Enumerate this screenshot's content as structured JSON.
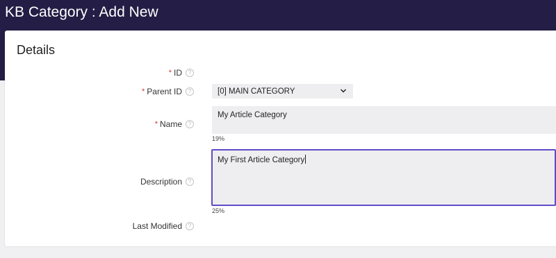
{
  "header": {
    "title": "KB Category : Add New"
  },
  "section": {
    "title": "Details"
  },
  "fields": {
    "id": {
      "label": "ID",
      "required": "*"
    },
    "parent_id": {
      "label": "Parent ID",
      "required": "*",
      "value": "[0] MAIN CATEGORY"
    },
    "name": {
      "label": "Name",
      "required": "*",
      "value": "My Article Category",
      "fill_percent": "19%"
    },
    "description": {
      "label": "Description",
      "value": "My First Article Category",
      "fill_percent": "25%"
    },
    "last_modified": {
      "label": "Last Modified"
    }
  },
  "icons": {
    "help": "question-circle-icon",
    "dropdown": "chevron-down-icon"
  },
  "colors": {
    "header": "#241d45",
    "focus_border": "#5f4bc6",
    "required": "#d63333",
    "input_bg": "#eeeef1"
  }
}
